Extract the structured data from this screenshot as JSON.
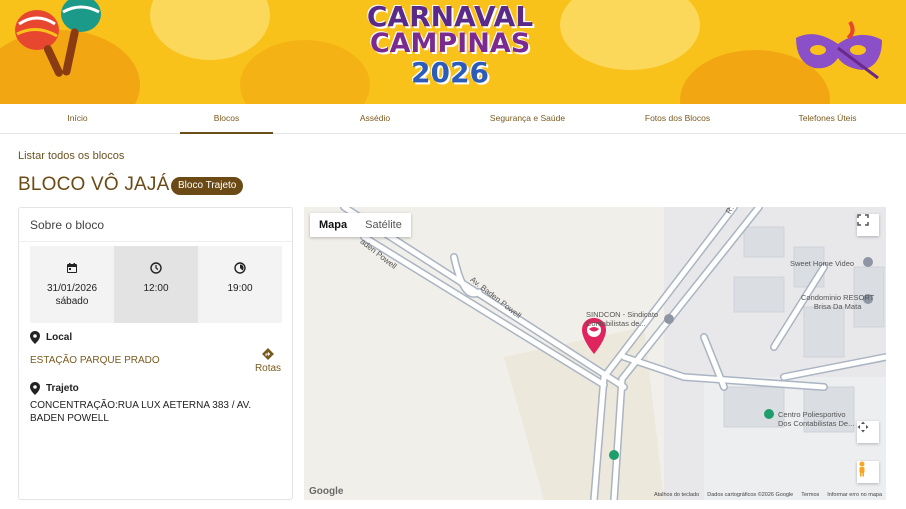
{
  "banner": {
    "line1": "CARNAVAL",
    "line2": "CAMPINAS",
    "line3": "2026"
  },
  "nav": {
    "items": [
      "Início",
      "Blocos",
      "Assédio",
      "Segurança e Saúde",
      "Fotos dos Blocos",
      "Telefones Úteis"
    ],
    "active": "Blocos"
  },
  "breadcrumb": "Listar todos os blocos",
  "title": "BLOCO VÔ JAJÁ",
  "badge": "Bloco Trajeto",
  "about": {
    "heading": "Sobre o bloco",
    "date": "31/01/2026",
    "weekday": "sábado",
    "start_time": "12:00",
    "end_time": "19:00",
    "local_label": "Local",
    "local_value": "ESTAÇÃO PARQUE PRADO",
    "rotas_label": "Rotas",
    "trajeto_label": "Trajeto",
    "trajeto_value": "CONCENTRAÇÃO:RUA LUX AETERNA 383 / AV. BADEN POWELL"
  },
  "map": {
    "tab_map": "Mapa",
    "tab_satellite": "Satélite",
    "labels": {
      "road1": "Av. Baden Powell",
      "road2": "Av. Baden Powell",
      "road3": "aden Powell",
      "road4": "R. L",
      "sweet_home": "Sweet Home Video",
      "condominio_1": "Condominio RESORT",
      "condominio_2": "Brisa Da Mata",
      "sindcon_1": "SINDCON - Sindicato",
      "sindcon_2": "Contabilistas de...",
      "centro_1": "Centro Poliesportivo",
      "centro_2": "Dos Contabilistas De..."
    },
    "footer": {
      "shortcuts": "Atalhos do teclado",
      "map_data": "Dados cartográficos ©2026 Google",
      "terms": "Termos",
      "report": "Informar erro no mapa"
    },
    "google": "Google"
  },
  "colors": {
    "brand_brown": "#6b4a16",
    "banner_yellow": "#f8c21a",
    "pin_pink": "#e0245e"
  }
}
